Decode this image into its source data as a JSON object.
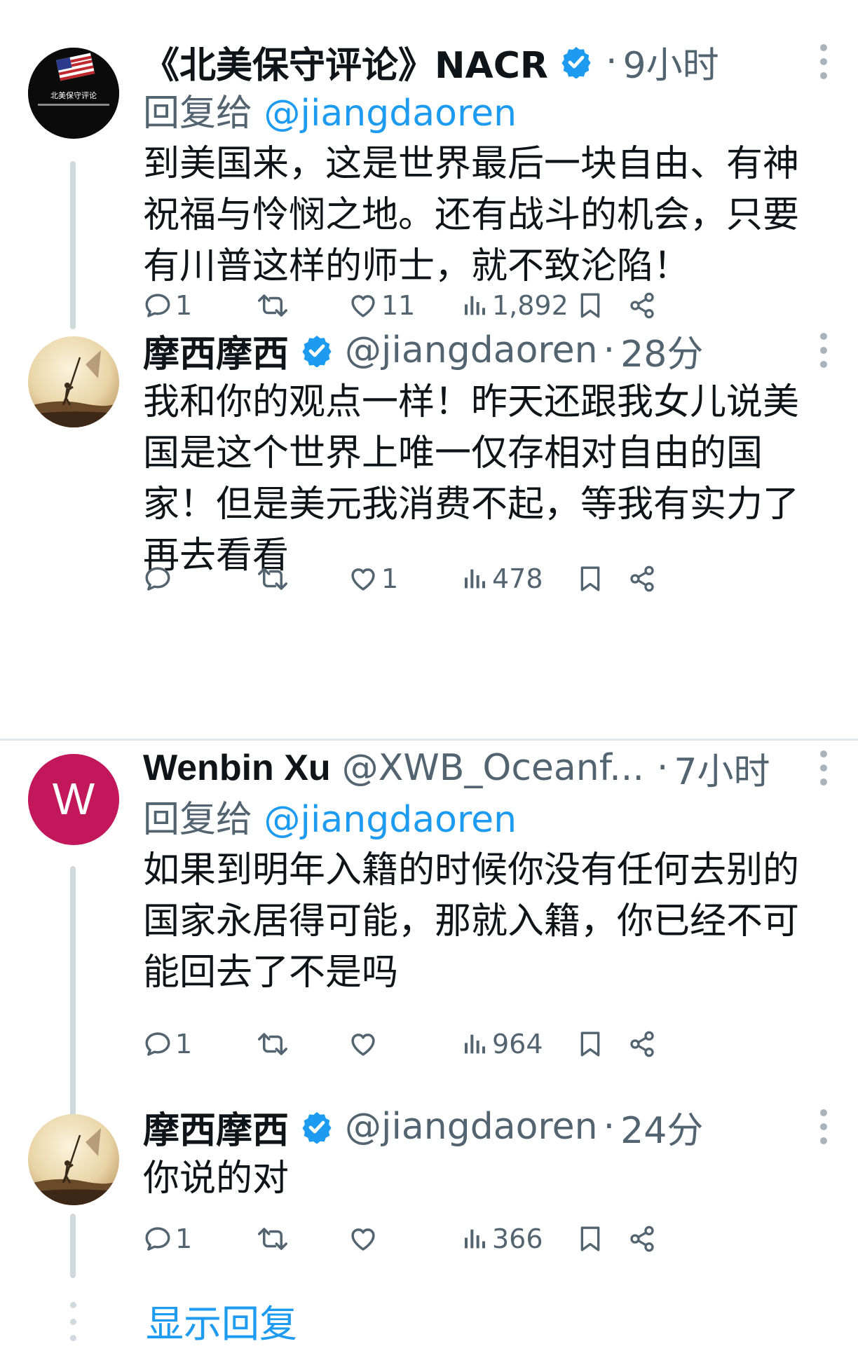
{
  "tweets": [
    {
      "name": "《北美保守评论》NACR",
      "verified": true,
      "handle": "",
      "dot": "·",
      "time": "9小时",
      "reply_prefix": "回复给 ",
      "reply_to": "@jiangdaoren",
      "text": "到美国来，这是世界最后一块自由、有神祝福与怜悯之地。还有战斗的机会，只要有川普这样的师士，就不致沦陷！",
      "replies": "1",
      "retweets": "",
      "likes": "11",
      "views": "1,892"
    },
    {
      "name": "摩西摩西",
      "verified": true,
      "handle": "@jiangdaoren",
      "dot": "·",
      "time": "28分",
      "text": "我和你的观点一样！昨天还跟我女儿说美国是这个世界上唯一仅存相对自由的国家！但是美元我消费不起，等我有实力了再去看看",
      "replies": "",
      "retweets": "",
      "likes": "1",
      "views": "478"
    },
    {
      "name": "Wenbin Xu",
      "verified": false,
      "avatar_letter": "W",
      "handle": "@XWB_Oceanf...",
      "dot": "·",
      "time": "7小时",
      "reply_prefix": "回复给 ",
      "reply_to": "@jiangdaoren",
      "text": "如果到明年入籍的时候你没有任何去别的国家永居得可能，那就入籍，你已经不可能回去了不是吗",
      "replies": "1",
      "retweets": "",
      "likes": "",
      "views": "964"
    },
    {
      "name": "摩西摩西",
      "verified": true,
      "handle": "@jiangdaoren",
      "dot": "·",
      "time": "24分",
      "text": "你说的对",
      "replies": "1",
      "retweets": "",
      "likes": "",
      "views": "366"
    }
  ],
  "show_replies": "显示回复",
  "avatar_caption": "北美保守评论",
  "colors": {
    "accent": "#1d9bf0",
    "secondary_text": "#536471",
    "wenbin_avatar": "#c2185b"
  },
  "icons": {
    "reply": "reply-icon",
    "retweet": "retweet-icon",
    "like": "heart-icon",
    "views": "views-icon",
    "bookmark": "bookmark-icon",
    "share": "share-icon",
    "more": "more-icon",
    "verified": "verified-badge-icon"
  }
}
